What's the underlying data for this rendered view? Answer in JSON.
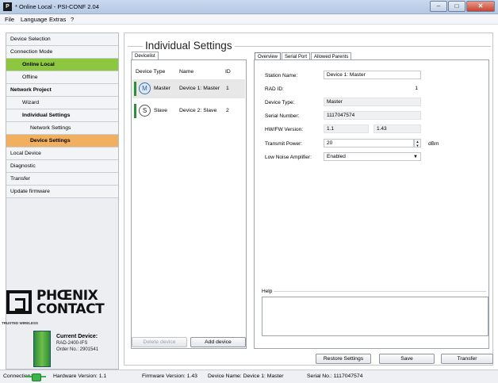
{
  "window": {
    "title": "* Online Local - PSI-CONF 2.04",
    "icon_letter": "P"
  },
  "menu": {
    "items": [
      "File",
      "Language",
      "Extras",
      "?"
    ]
  },
  "nav": {
    "items": [
      {
        "label": "Device Selection"
      },
      {
        "label": "Connection Mode"
      },
      {
        "label": "Online Local",
        "state": "active"
      },
      {
        "label": "Offline"
      },
      {
        "label": "Network Project"
      },
      {
        "label": "Wizard"
      },
      {
        "label": "Individual Settings"
      },
      {
        "label": "Network Settings"
      },
      {
        "label": "Device Settings",
        "state": "selected"
      },
      {
        "label": "Local Device"
      },
      {
        "label": "Diagnostic"
      },
      {
        "label": "Transfer"
      },
      {
        "label": "Update firmware"
      }
    ]
  },
  "logo": {
    "line1": "PHŒNIX",
    "line2": "CONTACT"
  },
  "current_device": {
    "trusted": "TRUSTED WIRELESS",
    "label": "Current Device:",
    "model": "RAD-2400-IFS",
    "order": "Order No.: 2901541"
  },
  "main": {
    "title": "Individual Settings",
    "devicelist_tab": "Devicelist",
    "columns": [
      "Device Type",
      "Name",
      "ID"
    ],
    "devices": [
      {
        "icon": "M",
        "type": "Master",
        "name": "Device 1: Master",
        "id": "1"
      },
      {
        "icon": "S",
        "type": "Slave",
        "name": "Device 2: Slave",
        "id": "2"
      }
    ],
    "delete_button": "Delete device",
    "add_button": "Add device",
    "tabs": [
      "Overview",
      "Serial Port",
      "Allowed Parents"
    ],
    "fields": {
      "station_name": {
        "label": "Station Name:",
        "value": "Device 1: Master"
      },
      "rad_id": {
        "label": "RAD ID:",
        "value": "1"
      },
      "device_type": {
        "label": "Device Type:",
        "value": "Master"
      },
      "serial_number": {
        "label": "Serial Number:",
        "value": "1117047574"
      },
      "hw_fw_version": {
        "label": "HW/FW Version:",
        "hw": "1.1",
        "fw": "1.43"
      },
      "transmit_power": {
        "label": "Transmit Power:",
        "value": "20",
        "unit": "dBm"
      },
      "low_noise_amplifier": {
        "label": "Low Noise Amplifier:",
        "value": "Enabled"
      }
    },
    "help_label": "Help"
  },
  "actions": {
    "restore": "Restore Settings",
    "save": "Save",
    "transfer": "Transfer"
  },
  "status": {
    "connection_label": "Connection:",
    "hardware_version": "Hardware Version: 1.1",
    "firmware_version": "Firmware Version: 1.43",
    "device_name": "Device Name: Device 1: Master",
    "serial_no": "Serial No.: 1117047574"
  }
}
